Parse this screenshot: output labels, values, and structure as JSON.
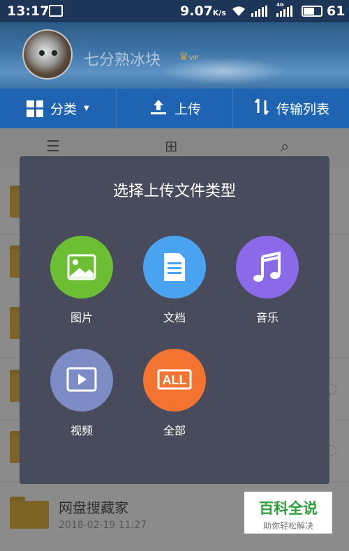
{
  "status_bar": {
    "time": "13:17",
    "speed": "9.07",
    "speed_unit": "K/s",
    "network": "4G",
    "battery": "61"
  },
  "profile": {
    "username": "七分熟冰块",
    "vip": "VIP"
  },
  "tabs": [
    {
      "label": "分类",
      "icon": "grid-icon"
    },
    {
      "label": "上传",
      "icon": "upload-icon"
    },
    {
      "label": "传输列表",
      "icon": "transfer-icon"
    }
  ],
  "file_list": {
    "visible_file": {
      "name": "网盘搜藏家",
      "date": "2018-02-19  11:27"
    }
  },
  "dialog": {
    "title": "选择上传文件类型",
    "options": [
      {
        "label": "图片",
        "icon": "image-icon",
        "color": "#6cbe33"
      },
      {
        "label": "文档",
        "icon": "document-icon",
        "color": "#4aa3f0"
      },
      {
        "label": "音乐",
        "icon": "music-icon",
        "color": "#8a6ae8"
      },
      {
        "label": "视频",
        "icon": "video-icon",
        "color": "#7d8cc5"
      },
      {
        "label": "全部",
        "icon": "all-icon",
        "color": "#f27430",
        "icon_text": "ALL"
      }
    ]
  },
  "watermark": {
    "title": "百科全说",
    "subtitle": "助你轻松解决"
  }
}
